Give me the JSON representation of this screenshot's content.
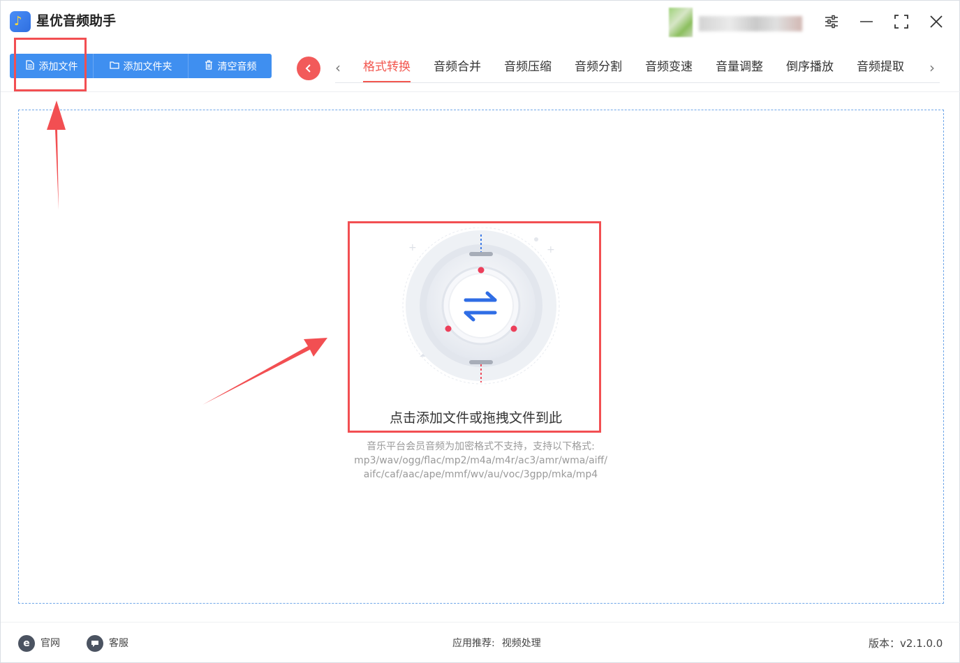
{
  "app": {
    "title": "星优音频助手"
  },
  "toolbar": {
    "add_file": "添加文件",
    "add_folder": "添加文件夹",
    "clear_audio": "清空音频"
  },
  "tabs": [
    {
      "label": "格式转换",
      "active": true
    },
    {
      "label": "音频合并"
    },
    {
      "label": "音频压缩"
    },
    {
      "label": "音频分割"
    },
    {
      "label": "音频变速"
    },
    {
      "label": "音量调整"
    },
    {
      "label": "倒序播放"
    },
    {
      "label": "音频提取"
    }
  ],
  "dropzone": {
    "title": "点击添加文件或拖拽文件到此",
    "note_line1": "音乐平台会员音频为加密格式不支持，支持以下格式:",
    "note_line2": "mp3/wav/ogg/flac/mp2/m4a/m4r/ac3/amr/wma/aiff/",
    "note_line3": "aifc/caf/aac/ape/mmf/wv/au/voc/3gpp/mka/mp4"
  },
  "footer": {
    "site": "官网",
    "service": "客服",
    "recommend_label": "应用推荐:",
    "recommend_value": "视频处理",
    "version": "版本：v2.1.0.0"
  },
  "colors": {
    "accent_blue": "#3f8ff0",
    "active_tab": "#f2574f",
    "annotation_red": "#f24f52"
  },
  "icons": {
    "app_logo": "music-note-icon",
    "settings": "sliders-icon",
    "minimize": "minimize-icon",
    "maximize": "maximize-icon",
    "close": "close-icon"
  }
}
